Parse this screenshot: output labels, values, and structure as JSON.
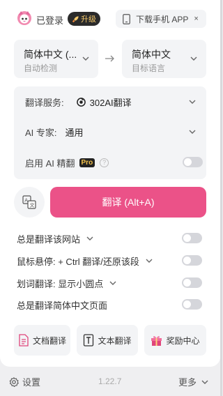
{
  "header": {
    "status": "已登录",
    "upgrade_label": "升级",
    "download_label": "下载手机 APP",
    "close_symbol": "×"
  },
  "languages": {
    "source": {
      "main": "简体中文 (...",
      "sub": "自动检测"
    },
    "target": {
      "main": "简体中文",
      "sub": "目标语言"
    }
  },
  "settings": {
    "service_label": "翻译服务:",
    "service_value": "302AI翻译",
    "expert_label": "AI 专家:",
    "expert_value": "通用",
    "ai_refine_label": "启用 AI 精翻",
    "pro_badge": "Pro",
    "help_symbol": "?"
  },
  "translate_button": "翻译 (Alt+A)",
  "options": [
    {
      "label": "总是翻译该网站",
      "has_dropdown": true
    },
    {
      "label": "鼠标悬停:  + Ctrl 翻译/还原该段",
      "has_dropdown": true
    },
    {
      "label": "划词翻译:  显示小圆点",
      "has_dropdown": true
    },
    {
      "label": "总是翻译简体中文页面",
      "has_dropdown": false
    }
  ],
  "tools": {
    "doc": "文档翻译",
    "text": "文本翻译",
    "reward": "奖励中心"
  },
  "footer": {
    "settings": "设置",
    "version": "1.22.7",
    "more": "更多"
  },
  "colors": {
    "accent": "#eb5288",
    "toggle_off": "#d5d6db",
    "panel_bg": "#f3f4f6"
  }
}
